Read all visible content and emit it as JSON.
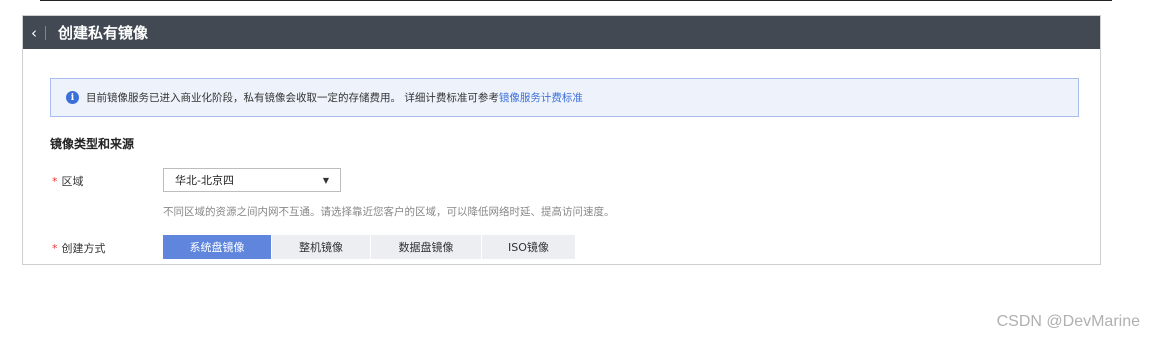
{
  "header": {
    "back_icon": "chevron-left-icon",
    "title": "创建私有镜像"
  },
  "notice": {
    "icon": "info-icon",
    "text": "目前镜像服务已进入商业化阶段，私有镜像会收取一定的存储费用。 详细计费标准可参考",
    "link": "镜像服务计费标准"
  },
  "section": {
    "title": "镜像类型和来源"
  },
  "region": {
    "required_mark": "*",
    "label": "区域",
    "selected": "华北-北京四",
    "hint": "不同区域的资源之间内网不互通。请选择靠近您客户的区域，可以降低网络时延、提高访问速度。"
  },
  "create_method": {
    "required_mark": "*",
    "label": "创建方式",
    "options": [
      "系统盘镜像",
      "整机镜像",
      "数据盘镜像",
      "ISO镜像"
    ],
    "active_index": 0
  },
  "watermark": "CSDN @DevMarine"
}
